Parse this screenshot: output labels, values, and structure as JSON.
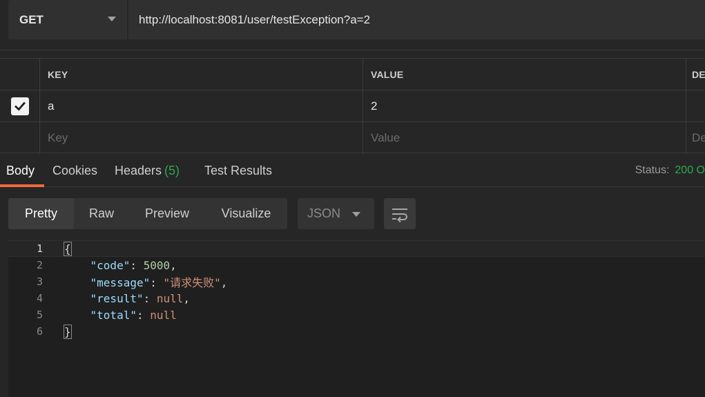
{
  "request": {
    "method": "GET",
    "url": "http://localhost:8081/user/testException?a=2"
  },
  "params": {
    "headers": {
      "key": "KEY",
      "value": "VALUE",
      "description": "DE"
    },
    "rows": [
      {
        "checked": true,
        "key": "a",
        "value": "2"
      }
    ],
    "placeholder": {
      "key": "Key",
      "value": "Value",
      "description": "De"
    }
  },
  "response_tabs": {
    "body": "Body",
    "cookies": "Cookies",
    "headers": "Headers",
    "headers_count": "(5)",
    "test_results": "Test Results",
    "status_label": "Status:",
    "status_value": "200 O"
  },
  "view": {
    "pretty": "Pretty",
    "raw": "Raw",
    "preview": "Preview",
    "visualize": "Visualize",
    "format": "JSON"
  },
  "body_json": {
    "line_numbers": [
      "1",
      "2",
      "3",
      "4",
      "5",
      "6"
    ],
    "open_brace": "{",
    "close_brace": "}",
    "fields": [
      {
        "key": "\"code\"",
        "value": "5000",
        "trail": ","
      },
      {
        "key": "\"message\"",
        "value": "\"请求失败\"",
        "trail": ","
      },
      {
        "key": "\"result\"",
        "value": "null",
        "trail": ","
      },
      {
        "key": "\"total\"",
        "value": "null",
        "trail": ""
      }
    ]
  },
  "colors": {
    "accent": "#f26b3a",
    "success": "#2fa84f",
    "json_key": "#9cdcfe",
    "json_number": "#b5cea8",
    "json_string": "#ce9178"
  }
}
